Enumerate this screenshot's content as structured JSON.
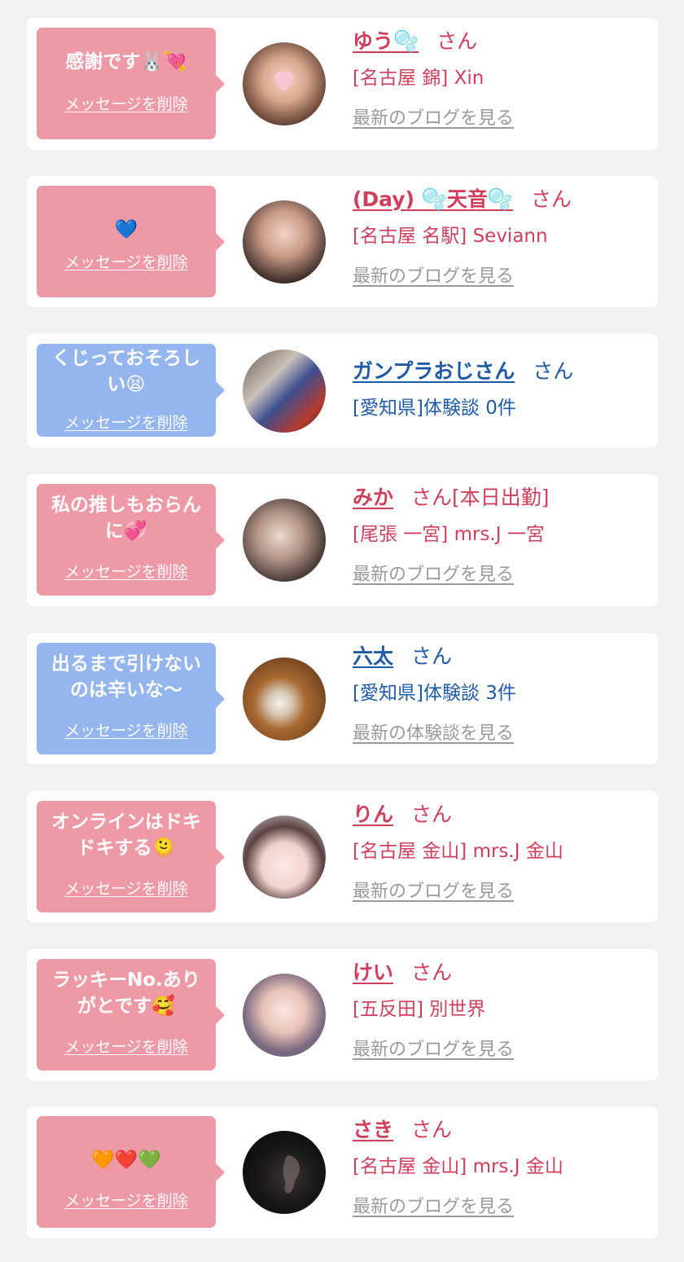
{
  "delete_label": "メッセージを削除",
  "san_label": "さん",
  "colors": {
    "pink_bubble": "#ee9aa6",
    "blue_bubble": "#94b5ee",
    "pink_text": "#cf3f5c",
    "blue_text": "#1f5aa6",
    "link_gray": "#9a9a9a"
  },
  "cards": [
    {
      "message": "感謝です🐰💘",
      "name": "ゆう🫧",
      "san_suffix": "さん",
      "shop": "[名古屋 錦] Xin",
      "link": "最新のブログを見る",
      "theme": "pink"
    },
    {
      "message": "💙",
      "name": "(Day) 🫧天音🫧",
      "san_suffix": "さん",
      "shop": "[名古屋 名駅] Seviann",
      "link": "最新のブログを見る",
      "theme": "pink"
    },
    {
      "message": "くじっておそろしい😫",
      "name": "ガンプラおじさん",
      "san_suffix": "さん",
      "shop": "[愛知県]体験談 0件",
      "link": "",
      "theme": "blue"
    },
    {
      "message": "私の推しもおらんに💞",
      "name": "みか",
      "san_suffix": "さん[本日出勤]",
      "shop": "[尾張 一宮] mrs.J 一宮",
      "link": "最新のブログを見る",
      "theme": "pink"
    },
    {
      "message": "出るまで引けないのは辛いな〜",
      "name": "六太",
      "san_suffix": "さん",
      "shop": "[愛知県]体験談 3件",
      "link": "最新の体験談を見る",
      "theme": "blue"
    },
    {
      "message": "オンラインはドキドキする🫠",
      "name": "りん",
      "san_suffix": "さん",
      "shop": "[名古屋 金山] mrs.J 金山",
      "link": "最新のブログを見る",
      "theme": "pink"
    },
    {
      "message": "ラッキーNo.ありがとです🥰",
      "name": "けい",
      "san_suffix": "さん",
      "shop": "[五反田] 別世界",
      "link": "最新のブログを見る",
      "theme": "pink"
    },
    {
      "message": "🧡❤️💚",
      "name": "さき",
      "san_suffix": "さん",
      "shop": "[名古屋 金山] mrs.J 金山",
      "link": "最新のブログを見る",
      "theme": "pink"
    }
  ]
}
